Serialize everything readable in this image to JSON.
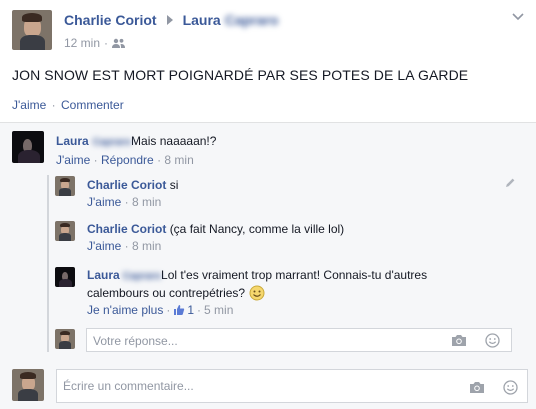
{
  "post": {
    "author": "Charlie Coriot",
    "recipient": "Laura",
    "recipient_surname": "Capraro",
    "time": "12 min",
    "separator": "·",
    "text": "JON SNOW EST MORT POIGNARDÉ PAR SES POTES DE LA GARDE",
    "like_label": "J'aime",
    "comment_label": "Commenter"
  },
  "comments": [
    {
      "author": "Laura",
      "author_surname": "Capraro",
      "text": "Mais naaaaan!?",
      "like_label": "J'aime",
      "reply_label": "Répondre",
      "time": "8 min"
    }
  ],
  "replies": [
    {
      "author": "Charlie Coriot",
      "text": "si",
      "like_label": "J'aime",
      "time": "8 min"
    },
    {
      "author": "Charlie Coriot",
      "text": "(ça fait Nancy, comme la ville lol)",
      "like_label": "J'aime",
      "time": "8 min"
    },
    {
      "author": "Laura",
      "author_surname": "Capraro",
      "text_line1": "Lol t'es vraiment trop marrant! Connais-tu d'autres",
      "text_line2": "calembours ou contrepétries?",
      "unlike_label": "Je n'aime plus",
      "like_count": "1",
      "time": "5 min"
    }
  ],
  "reply_input": {
    "placeholder": "Votre réponse..."
  },
  "comment_input": {
    "placeholder": "Écrire un commentaire..."
  },
  "icons": {
    "audience": "friends-icon",
    "menu": "chevron-down-icon",
    "edit": "pencil-icon",
    "camera": "camera-icon",
    "emoji": "smiley-icon",
    "like": "thumbs-up-icon"
  },
  "colors": {
    "link": "#3b5998",
    "muted": "#9197a3",
    "background": "#f6f7f9"
  }
}
